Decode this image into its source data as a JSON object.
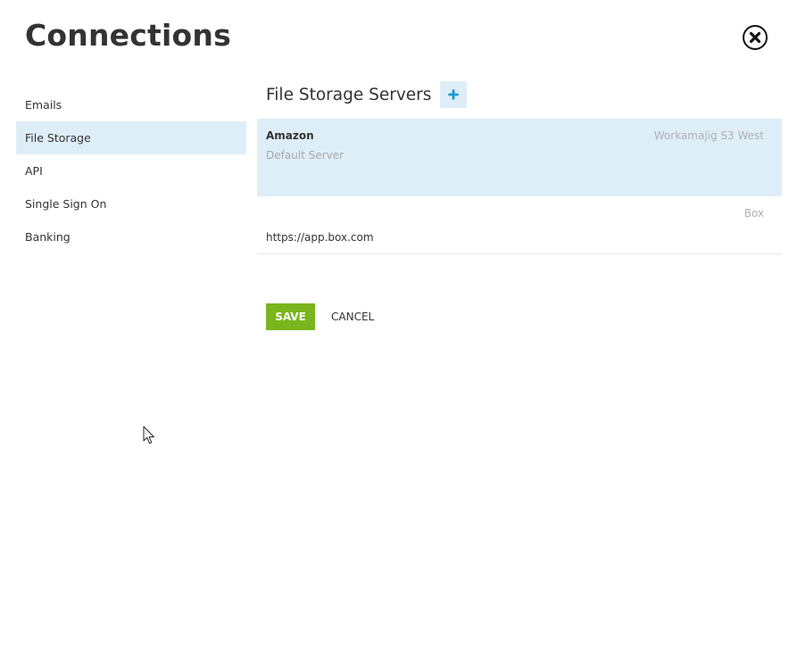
{
  "page": {
    "title": "Connections"
  },
  "header": {
    "close_icon": "close-circle-icon"
  },
  "sidebar": {
    "items": [
      {
        "label": "Emails",
        "active": false
      },
      {
        "label": "File Storage",
        "active": true
      },
      {
        "label": "API",
        "active": false
      },
      {
        "label": "Single Sign On",
        "active": false
      },
      {
        "label": "Banking",
        "active": false
      }
    ]
  },
  "main": {
    "section_title": "File Storage Servers",
    "add_icon": "plus-icon",
    "servers": [
      {
        "name": "Amazon",
        "subtitle": "Default Server",
        "type": "Workamajig S3 West",
        "selected": true
      },
      {
        "url": "https://app.box.com",
        "type": "Box",
        "selected": false
      }
    ],
    "save_label": "SAVE",
    "cancel_label": "CANCEL"
  },
  "colors": {
    "accent_light": "#deeef9",
    "accent_blue": "#1a9ad6",
    "save_green": "#7ab51d",
    "text_dark": "#333333",
    "text_muted": "#a8a8a8"
  }
}
